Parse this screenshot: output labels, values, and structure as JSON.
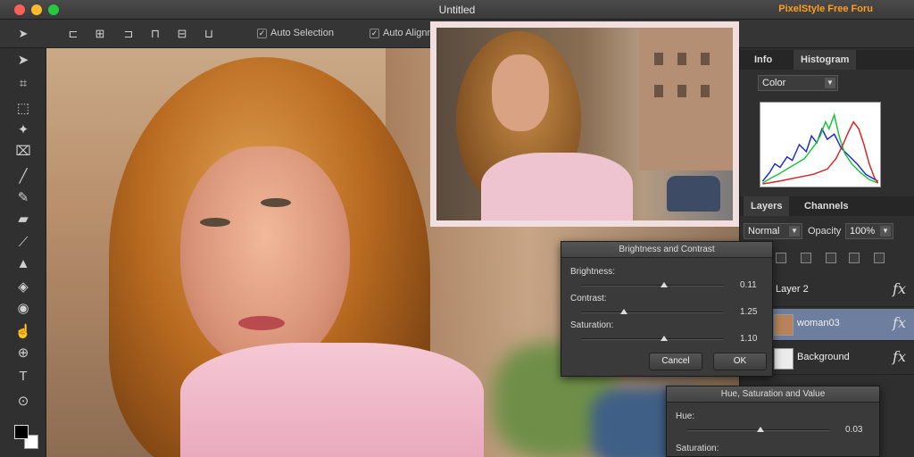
{
  "window": {
    "title": "Untitled",
    "brand": "PixelStyle Free Foru"
  },
  "options_bar": {
    "auto_selection_label": "Auto Selection",
    "auto_align_label": "Auto Alignm"
  },
  "right_panel": {
    "top_tabs": [
      "Info",
      "Histogram"
    ],
    "histogram_channel": "Color",
    "layer_tabs": [
      "Layers",
      "Channels"
    ],
    "blend_mode": "Normal",
    "opacity_label": "Opacity",
    "opacity_value": "100%",
    "layers": [
      {
        "name": "Layer 2",
        "selected": false
      },
      {
        "name": "woman03",
        "selected": true
      },
      {
        "name": "Background",
        "selected": false
      }
    ],
    "fx_label": "fx"
  },
  "brightness_dialog": {
    "title": "Brightness and Contrast",
    "brightness_label": "Brightness:",
    "brightness_value": "0.11",
    "contrast_label": "Contrast:",
    "contrast_value": "1.25",
    "saturation_label": "Saturation:",
    "saturation_value": "1.10",
    "cancel_label": "Cancel",
    "ok_label": "OK"
  },
  "hsv_dialog": {
    "title": "Hue, Saturation and Value",
    "hue_label": "Hue:",
    "hue_value": "0.03",
    "saturation_label": "Saturation:"
  },
  "colors": {
    "accent": "#ff9f1a",
    "selection": "#6e7e9e",
    "foreground": "#000000",
    "background": "#ffffff"
  },
  "icons": {
    "tools": [
      "move-tool-icon",
      "transform-tool-icon",
      "marquee-tool-icon",
      "magic-wand-icon",
      "crop-icon",
      "brush-icon",
      "pencil-icon",
      "eraser-icon",
      "eyedropper-icon",
      "stamp-icon",
      "paint-bucket-icon",
      "red-eye-icon",
      "smudge-icon",
      "zoom-icon",
      "text-icon",
      "hand-icon"
    ]
  }
}
